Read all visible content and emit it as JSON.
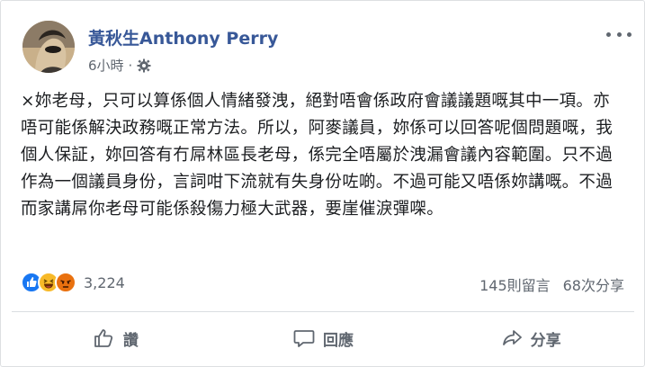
{
  "post": {
    "author": "黃秋生Anthony Perry",
    "time": "6小時",
    "separator": "·",
    "text": "×妳老母，只可以算係個人情緒發洩，絕對唔會係政府會議議題嘅其中一項。亦唔可能係解決政務嘅正常方法。所以，阿麥議員，妳係可以回答呢個問題嘅，我個人保証，妳回答有冇屌林區長老母，係完全唔屬於洩漏會議內容範圍。只不過作為一個議員身份，言詞咁下流就有失身份咗啲。不過可能又唔係妳講嘅。不過而家講屌你老母可能係殺傷力極大武器，要崖催淚彈㗎。"
  },
  "reactions": {
    "icons": [
      "like-icon",
      "haha-icon",
      "angry-icon"
    ],
    "colors": {
      "like": "#1877f2",
      "haha": "#f7b928",
      "angry": "#e9710f"
    },
    "count": "3,224"
  },
  "stats": {
    "comments": "145則留言",
    "shares": "68次分享"
  },
  "actions": {
    "like": "讚",
    "comment": "回應",
    "share": "分享"
  },
  "colors": {
    "author": "#385898",
    "secondary_text": "#606770"
  }
}
